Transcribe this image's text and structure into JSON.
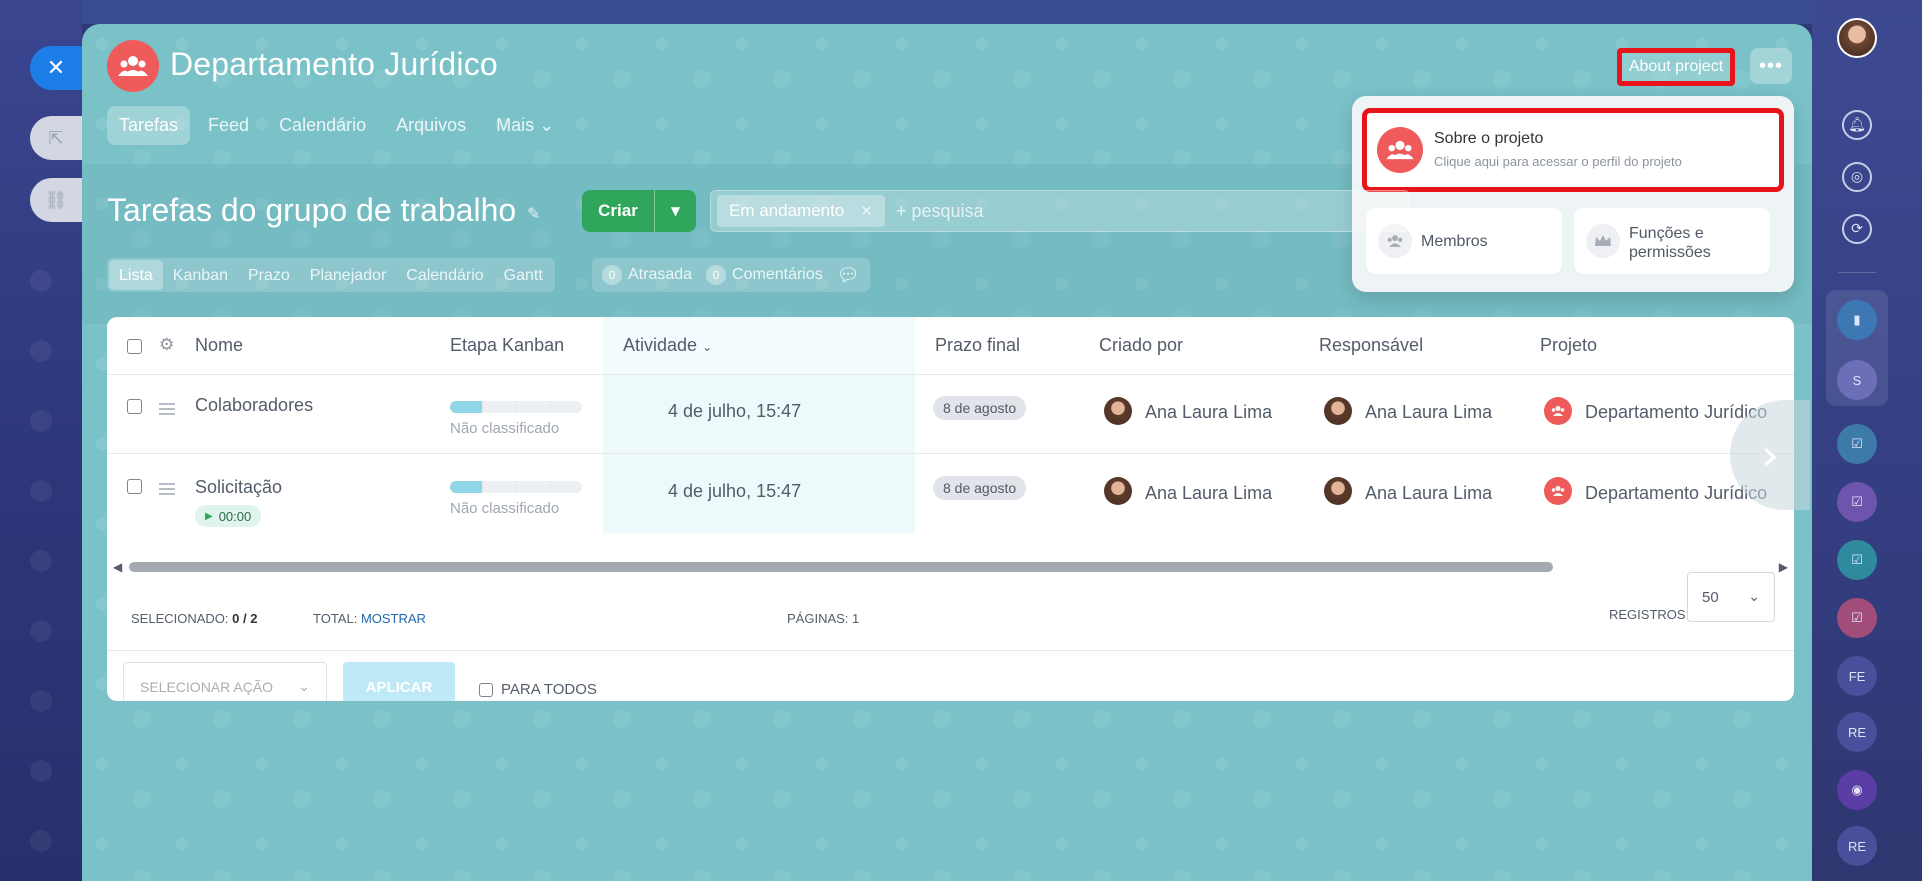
{
  "project": {
    "title": "Departamento Jurídico",
    "about_button": "About project",
    "more_button": "•••"
  },
  "nav_tabs": [
    "Tarefas",
    "Feed",
    "Calendário",
    "Arquivos",
    "Mais ⌄"
  ],
  "popup": {
    "main_title": "Sobre o projeto",
    "main_subtitle": "Clique aqui para acessar o perfil do projeto",
    "members_label": "Membros",
    "roles_label_line1": "Funções e",
    "roles_label_line2": "permissões"
  },
  "toolbar": {
    "section_title": "Tarefas do grupo de trabalho",
    "create_label": "Criar",
    "filter_chip": "Em andamento",
    "search_placeholder": "+ pesquisa"
  },
  "views": [
    "Lista",
    "Kanban",
    "Prazo",
    "Planejador",
    "Calendário",
    "Gantt"
  ],
  "counters": [
    {
      "count": "0",
      "label": "Atrasada"
    },
    {
      "count": "0",
      "label": "Comentários"
    }
  ],
  "table": {
    "headers": {
      "name": "Nome",
      "kanban": "Etapa Kanban",
      "activity": "Atividade",
      "deadline": "Prazo final",
      "created_by": "Criado por",
      "responsible": "Responsável",
      "project": "Projeto"
    },
    "rows": [
      {
        "name": "Colaboradores",
        "kanban_stage": "Não classificado",
        "kanban_progress": 0.25,
        "activity": "4 de julho, 15:47",
        "deadline": "8 de agosto",
        "created_by": "Ana Laura Lima",
        "responsible": "Ana Laura Lima",
        "project": "Departamento Jurídico"
      },
      {
        "name": "Solicitação",
        "timer": "00:00",
        "kanban_stage": "Não classificado",
        "kanban_progress": 0.25,
        "activity": "4 de julho, 15:47",
        "deadline": "8 de agosto",
        "created_by": "Ana Laura Lima",
        "responsible": "Ana Laura Lima",
        "project": "Departamento Jurídico"
      }
    ]
  },
  "footer": {
    "selected_label": "Selecionado:",
    "selected_value": "0 / 2",
    "total_label": "Total:",
    "total_link": "Mostrar",
    "pages_label": "Páginas:",
    "pages_value": "1",
    "records_label": "Registros:",
    "records_value": "50",
    "action_placeholder": "Selecionar ação",
    "apply_label": "Aplicar",
    "all_label": "Para todos"
  },
  "right_bar": {
    "initials": [
      "S",
      "FE",
      "RE",
      "RE"
    ]
  },
  "colors": {
    "accent_red": "#e8141c",
    "create_green": "#2fa65b",
    "project_red": "#ef5b5b",
    "panel_teal": "#7ac2c8"
  }
}
